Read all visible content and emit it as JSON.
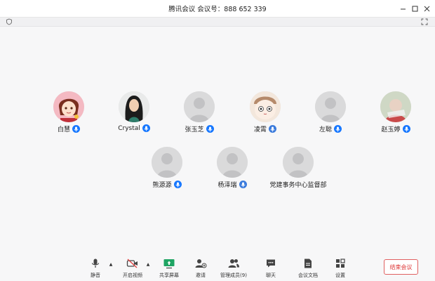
{
  "window": {
    "title": "腾讯会议  会议号：888 652 339"
  },
  "participants": [
    {
      "name": "白慧",
      "avatar": "anime-girl-avatar",
      "mic": "unmuted"
    },
    {
      "name": "Crystal",
      "avatar": "cartoon-woman-avatar",
      "mic": "unmuted"
    },
    {
      "name": "张玉芝",
      "avatar": "default-avatar",
      "mic": "unmuted"
    },
    {
      "name": "凌霄",
      "avatar": "cartoon-face-avatar",
      "mic": "active"
    },
    {
      "name": "左聪",
      "avatar": "default-avatar",
      "mic": "unmuted"
    },
    {
      "name": "赵玉婷",
      "avatar": "photo-avatar",
      "mic": "unmuted"
    },
    {
      "name": "熊源源",
      "avatar": "default-avatar",
      "mic": "unmuted"
    },
    {
      "name": "杨泽瑞",
      "avatar": "default-avatar",
      "mic": "active"
    },
    {
      "name": "党建事务中心监督部",
      "avatar": "default-avatar",
      "mic": "none"
    }
  ],
  "toolbar": {
    "mute": "静音",
    "video": "开启视频",
    "share": "共享屏幕",
    "invite": "邀请",
    "members": "管理成员(9)",
    "chat": "聊天",
    "docs": "会议文档",
    "settings": "设置",
    "end": "结束会议"
  },
  "colors": {
    "accent": "#1677ff",
    "end_button": "#d33333",
    "share_green": "#1fa463",
    "video_red": "#e04444"
  }
}
